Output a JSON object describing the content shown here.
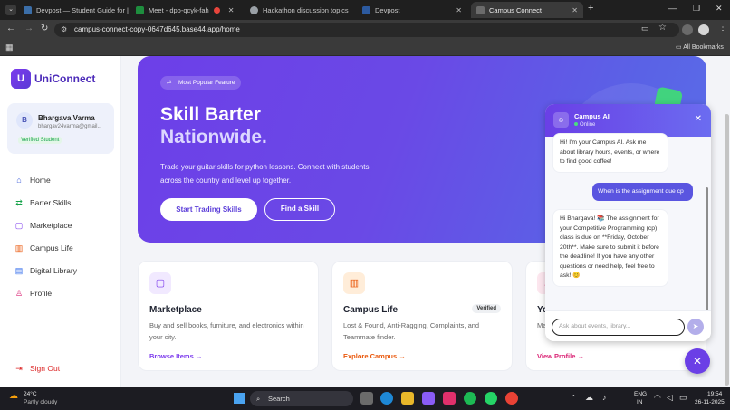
{
  "browser": {
    "tabs": [
      {
        "label": "Devpost — Student Guide for |",
        "color": "#3b6ea8"
      },
      {
        "label": "Meet - dpo-qcyk-fah",
        "color": "#1e8e3e"
      },
      {
        "label": "",
        "color": "#e8453c"
      },
      {
        "label": "Hackathon discussion topics",
        "color": "#9aa0a6"
      },
      {
        "label": "Devpost",
        "color": "#2c5aa0"
      },
      {
        "label": "Campus Connect",
        "color": "#6b6b6b"
      }
    ],
    "new_tab": "+",
    "url": "campus-connect-copy-0647d645.base44.app/home",
    "bookmarks_label": "All Bookmarks"
  },
  "sidebar": {
    "logo_letter": "U",
    "app_name": "UniConnect",
    "user": {
      "initial": "B",
      "name": "Bhargava Varma",
      "email": "bhargav24varma@gmail...",
      "badge": "Verified Student"
    },
    "nav": [
      {
        "label": "Home",
        "icon": "home-icon",
        "glyph": "⌂",
        "color": "#3a5bd9"
      },
      {
        "label": "Barter Skills",
        "icon": "swap-icon",
        "glyph": "⇄",
        "color": "#16a34a"
      },
      {
        "label": "Marketplace",
        "icon": "shopping-bag-icon",
        "glyph": "▢",
        "color": "#7c3aed"
      },
      {
        "label": "Campus Life",
        "icon": "building-icon",
        "glyph": "▥",
        "color": "#ea580c"
      },
      {
        "label": "Digital Library",
        "icon": "book-icon",
        "glyph": "▤",
        "color": "#2563eb"
      },
      {
        "label": "Profile",
        "icon": "user-icon",
        "glyph": "♙",
        "color": "#db2777"
      }
    ],
    "sign_out": "Sign Out"
  },
  "hero": {
    "badge": "Most Popular Feature",
    "title_line1": "Skill Barter",
    "title_line2": "Nationwide.",
    "description": "Trade your guitar skills for python lessons. Connect with students across the country and level up together.",
    "primary_button": "Start Trading Skills",
    "secondary_button": "Find a Skill"
  },
  "cards": [
    {
      "title": "Marketplace",
      "text": "Buy and sell books, furniture, and electronics within your city.",
      "link": "Browse Items →",
      "link_color": "#7c3aed",
      "icon": "shopping-bag-icon",
      "icon_bg": "#f1e9ff",
      "icon_color": "#7c3aed",
      "badge": ""
    },
    {
      "title": "Campus Life",
      "text": "Lost & Found, Anti-Ragging, Complaints, and Teammate finder.",
      "link": "Explore Campus →",
      "link_color": "#ea580c",
      "icon": "building-icon",
      "icon_bg": "#ffedd9",
      "icon_color": "#ea580c",
      "badge": "Verified"
    },
    {
      "title": "Yo",
      "text": "Ma",
      "link": "View Profile →",
      "link_color": "#db2777",
      "icon": "user-icon",
      "icon_bg": "#fde7ef",
      "icon_color": "#db2777",
      "badge": ""
    }
  ],
  "chat": {
    "title": "Campus AI",
    "status": "Online",
    "messages": [
      {
        "from": "bot",
        "text": "Hi! I'm your Campus AI. Ask me about library hours, events, or where to find good coffee!"
      },
      {
        "from": "user",
        "text": "When is the assignment due cp"
      },
      {
        "from": "bot",
        "text": "Hi Bhargava! 📚 The assignment for your Competitive Programming (cp) class is due on **Friday, October 20th**. Make sure to submit it before the deadline! If you have any other questions or need help, feel free to ask! 😊"
      }
    ],
    "input_placeholder": "Ask about events, library..."
  },
  "taskbar": {
    "weather_temp": "24°C",
    "weather_desc": "Partly cloudy",
    "search": "Search",
    "lang_top": "ENG",
    "lang_bottom": "IN",
    "time": "19:54",
    "date": "26-11-2025"
  }
}
